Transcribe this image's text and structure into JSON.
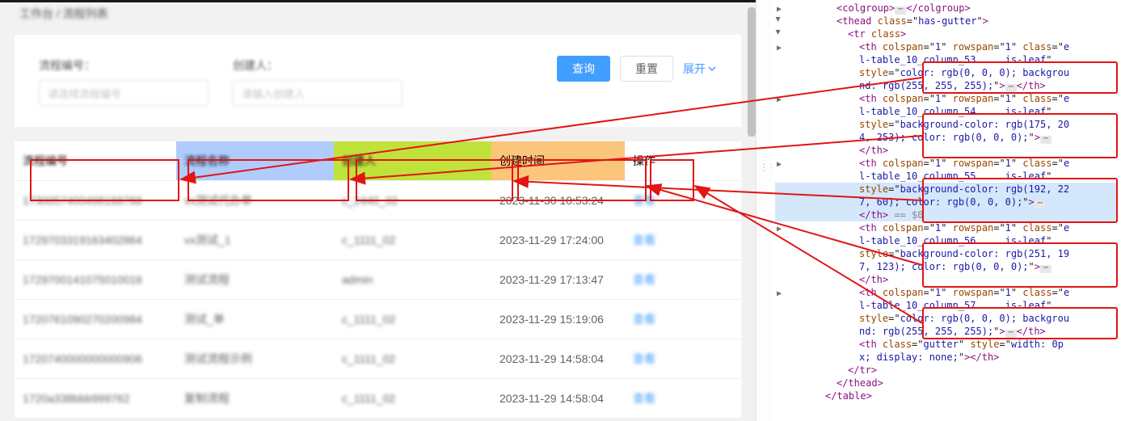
{
  "breadcrumb": "工作台 / 流程列表",
  "search": {
    "field1_label": "流程编号：",
    "field1_placeholder": "请选择流程编号",
    "field2_label": "创建人：",
    "field2_placeholder": "请输入创建人",
    "btn_query": "查询",
    "btn_reset": "重置",
    "expand": "展开"
  },
  "table": {
    "headers": [
      "流程编号",
      "流程名称",
      "创建人",
      "创建时间",
      "操作"
    ],
    "rows": [
      {
        "c0": "1730057400498168768",
        "c1": "vx测试代办单",
        "c2": "c_2440_02",
        "c3": "2023-11-30 10:53:24",
        "op": "查看"
      },
      {
        "c0": "1729703319163402864",
        "c1": "vx测试_1",
        "c2": "c_1111_02",
        "c3": "2023-11-29 17:24:00",
        "op": "查看"
      },
      {
        "c0": "1729700141075010016",
        "c1": "测试流程",
        "c2": "admin",
        "c3": "2023-11-29 17:13:47",
        "op": "查看"
      },
      {
        "c0": "1720761090270200984",
        "c1": "测试_单",
        "c2": "c_1111_02",
        "c3": "2023-11-29 15:19:06",
        "op": "查看"
      },
      {
        "c0": "1720740000000000906",
        "c1": "测试流程示例",
        "c2": "c_1111_02",
        "c3": "2023-11-29 14:58:04",
        "op": "查看"
      },
      {
        "c0": "1720a338bbb999762",
        "c1": "复制流程",
        "c2": "c_1111_02",
        "c3": "2023-11-29 14:58:04",
        "op": "查看"
      }
    ]
  },
  "header_styles": {
    "th1": {
      "bg": "rgb(255, 255, 255)",
      "col": "rgb(0, 0, 0)"
    },
    "th2": {
      "bg": "rgb(175, 204, 253)",
      "col": "rgb(0, 0, 0)"
    },
    "th3": {
      "bg": "rgb(192, 227, 60)",
      "col": "rgb(0, 0, 0)"
    },
    "th4": {
      "bg": "rgb(251, 197, 123)",
      "col": "rgb(0, 0, 0)"
    },
    "th5": {
      "bg": "rgb(255, 255, 255)",
      "col": "rgb(0, 0, 0)"
    }
  },
  "devtools": {
    "lines": [
      {
        "ind": 76,
        "tw": "r",
        "html": "<span class='tag'>&lt;colgroup&gt;</span><span class='ellip'>⋯</span><span class='tag'>&lt;/colgroup&gt;</span>"
      },
      {
        "ind": 76,
        "tw": "d",
        "html": "<span class='tag'>&lt;thead</span> <span class='attr-n'>class</span>=\"<span class='attr-v'>has-gutter</span>\"<span class='tag'>&gt;</span>"
      },
      {
        "ind": 90,
        "tw": "d",
        "html": "<span class='tag'>&lt;tr</span> <span class='attr-n'>class</span><span class='tag'>&gt;</span>"
      },
      {
        "ind": 104,
        "tw": "r",
        "html": "<span class='tag'>&lt;th</span> <span class='attr-n'>colspan</span>=\"<span class='attr-v'>1</span>\" <span class='attr-n'>rowspan</span>=\"<span class='attr-v'>1</span>\" <span class='attr-n'>class</span>=\"<span class='attr-v'>e</span>"
      },
      {
        "ind": 104,
        "html": "<span class='attr-v'>l-table_10_column_53     is-leaf</span>\""
      },
      {
        "ind": 104,
        "html": "<span class='attr-n'>style</span>=\"<span class='attr-v'>color: rgb(0, 0, 0); backgrou</span>"
      },
      {
        "ind": 104,
        "html": "<span class='attr-v'>nd: rgb(255, 255, 255);</span>\"<span class='tag'>&gt;</span><span class='ellip'>⋯</span><span class='tag'>&lt;/th&gt;</span>"
      },
      {
        "ind": 104,
        "tw": "r",
        "html": "<span class='tag'>&lt;th</span> <span class='attr-n'>colspan</span>=\"<span class='attr-v'>1</span>\" <span class='attr-n'>rowspan</span>=\"<span class='attr-v'>1</span>\" <span class='attr-n'>class</span>=\"<span class='attr-v'>e</span>"
      },
      {
        "ind": 104,
        "html": "<span class='attr-v'>l-table_10_column_54     is-leaf</span>\""
      },
      {
        "ind": 104,
        "html": "<span class='attr-n'>style</span>=\"<span class='attr-v'>background-color: rgb(175, 20</span>"
      },
      {
        "ind": 104,
        "html": "<span class='attr-v'>4, 253); color: rgb(0, 0, 0);</span>\"<span class='tag'>&gt;</span><span class='ellip'>⋯</span>"
      },
      {
        "ind": 104,
        "html": "<span class='tag'>&lt;/th&gt;</span>"
      },
      {
        "ind": 104,
        "tw": "r",
        "html": "<span class='tag'>&lt;th</span> <span class='attr-n'>colspan</span>=\"<span class='attr-v'>1</span>\" <span class='attr-n'>rowspan</span>=\"<span class='attr-v'>1</span>\" <span class='attr-n'>class</span>=\"<span class='attr-v'>e</span>"
      },
      {
        "ind": 104,
        "html": "<span class='attr-v'>l-table_10_column_55     is-leaf</span>\""
      },
      {
        "ind": 104,
        "sel": true,
        "html": "<span class='attr-n'>style</span>=\"<span class='attr-v'>background-color: rgb(192, 22</span>"
      },
      {
        "ind": 104,
        "sel": true,
        "html": "<span class='attr-v'>7, 60); color: rgb(0, 0, 0);</span>\"<span class='tag'>&gt;</span><span class='ellip'>⋯</span>"
      },
      {
        "ind": 104,
        "sel": true,
        "html": "<span class='tag'>&lt;/th&gt;</span> <span style='color:#888'>== $0</span>"
      },
      {
        "ind": 104,
        "tw": "r",
        "html": "<span class='tag'>&lt;th</span> <span class='attr-n'>colspan</span>=\"<span class='attr-v'>1</span>\" <span class='attr-n'>rowspan</span>=\"<span class='attr-v'>1</span>\" <span class='attr-n'>class</span>=\"<span class='attr-v'>e</span>"
      },
      {
        "ind": 104,
        "html": "<span class='attr-v'>l-table_10_column_56     is-leaf</span>\""
      },
      {
        "ind": 104,
        "html": "<span class='attr-n'>style</span>=\"<span class='attr-v'>background-color: rgb(251, 19</span>"
      },
      {
        "ind": 104,
        "html": "<span class='attr-v'>7, 123); color: rgb(0, 0, 0);</span>\"<span class='tag'>&gt;</span><span class='ellip'>⋯</span>"
      },
      {
        "ind": 104,
        "html": "<span class='tag'>&lt;/th&gt;</span>"
      },
      {
        "ind": 104,
        "tw": "r",
        "html": "<span class='tag'>&lt;th</span> <span class='attr-n'>colspan</span>=\"<span class='attr-v'>1</span>\" <span class='attr-n'>rowspan</span>=\"<span class='attr-v'>1</span>\" <span class='attr-n'>class</span>=\"<span class='attr-v'>e</span>"
      },
      {
        "ind": 104,
        "html": "<span class='attr-v'>l-table_10_column_57     is-leaf</span>\""
      },
      {
        "ind": 104,
        "html": "<span class='attr-n'>style</span>=\"<span class='attr-v'>color: rgb(0, 0, 0); backgrou</span>"
      },
      {
        "ind": 104,
        "html": "<span class='attr-v'>nd: rgb(255, 255, 255);</span>\"<span class='tag'>&gt;</span><span class='ellip'>⋯</span><span class='tag'>&lt;/th&gt;</span>"
      },
      {
        "ind": 104,
        "html": "<span class='tag'>&lt;th</span> <span class='attr-n'>class</span>=\"<span class='attr-v'>gutter</span>\" <span class='attr-n'>style</span>=\"<span class='attr-v'>width: 0p</span>"
      },
      {
        "ind": 104,
        "html": "<span class='attr-v'>x; display: none;</span>\"<span class='tag'>&gt;&lt;/th&gt;</span>"
      },
      {
        "ind": 90,
        "html": "<span class='tag'>&lt;/tr&gt;</span>"
      },
      {
        "ind": 76,
        "html": "<span class='tag'>&lt;/thead&gt;</span>"
      },
      {
        "ind": 62,
        "html": "<span class='tag'>&lt;/table&gt;</span>"
      }
    ]
  }
}
